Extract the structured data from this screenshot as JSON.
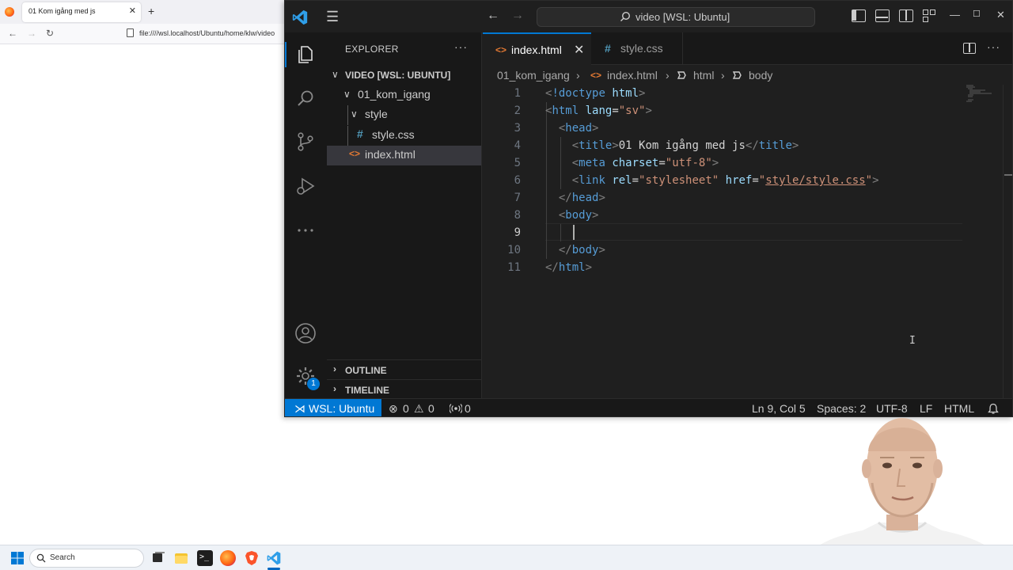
{
  "browser": {
    "tab_title": "01 Kom igång med js",
    "close_glyph": "✕",
    "newtab_glyph": "+",
    "back_glyph": "←",
    "forward_glyph": "→",
    "reload_glyph": "↻",
    "url": "file:////wsl.localhost/Ubuntu/home/klw/video"
  },
  "vscode": {
    "command_center": "video [WSL: Ubuntu]",
    "hamburger": "☰",
    "nav_back": "←",
    "nav_forward": "→",
    "win_min": "—",
    "win_max": "☐",
    "win_close": "✕",
    "explorer": {
      "title": "EXPLORER",
      "more": "···",
      "root": "VIDEO [WSL: UBUNTU]",
      "items": [
        {
          "label": "01_kom_igang",
          "chevron": "∨"
        },
        {
          "label": "style",
          "chevron": "∨"
        },
        {
          "label": "style.css",
          "icon": "#"
        },
        {
          "label": "index.html",
          "icon": "<>"
        }
      ],
      "outline": "OUTLINE",
      "timeline": "TIMELINE",
      "collapsed_chevron": "›",
      "root_chevron": "∨"
    },
    "tabs": [
      {
        "label": "index.html",
        "icon": "<>",
        "close": "✕"
      },
      {
        "label": "style.css",
        "icon": "#"
      }
    ],
    "tab_more": "···",
    "breadcrumbs": {
      "folder": "01_kom_igang",
      "file": "index.html",
      "html": "html",
      "body": "body",
      "sep": "›",
      "icon_html": "<>"
    },
    "editor": {
      "line_numbers": [
        "1",
        "2",
        "3",
        "4",
        "5",
        "6",
        "7",
        "8",
        "9",
        "10",
        "11"
      ],
      "lines": [
        [
          {
            "c": "t-punc",
            "t": "<"
          },
          {
            "c": "t-tag",
            "t": "!doctype"
          },
          {
            "c": "t-text",
            "t": " "
          },
          {
            "c": "t-attr",
            "t": "html"
          },
          {
            "c": "t-punc",
            "t": ">"
          }
        ],
        [
          {
            "c": "t-punc",
            "t": "<"
          },
          {
            "c": "t-tag",
            "t": "html"
          },
          {
            "c": "t-text",
            "t": " "
          },
          {
            "c": "t-attr",
            "t": "lang"
          },
          {
            "c": "t-text",
            "t": "="
          },
          {
            "c": "t-str",
            "t": "\"sv\""
          },
          {
            "c": "t-punc",
            "t": ">"
          }
        ],
        [
          {
            "c": "t-text",
            "t": "  "
          },
          {
            "c": "t-punc",
            "t": "<"
          },
          {
            "c": "t-tag",
            "t": "head"
          },
          {
            "c": "t-punc",
            "t": ">"
          }
        ],
        [
          {
            "c": "t-text",
            "t": "    "
          },
          {
            "c": "t-punc",
            "t": "<"
          },
          {
            "c": "t-tag",
            "t": "title"
          },
          {
            "c": "t-punc",
            "t": ">"
          },
          {
            "c": "t-text",
            "t": "01 Kom igång med js"
          },
          {
            "c": "t-punc",
            "t": "</"
          },
          {
            "c": "t-tag",
            "t": "title"
          },
          {
            "c": "t-punc",
            "t": ">"
          }
        ],
        [
          {
            "c": "t-text",
            "t": "    "
          },
          {
            "c": "t-punc",
            "t": "<"
          },
          {
            "c": "t-tag",
            "t": "meta"
          },
          {
            "c": "t-text",
            "t": " "
          },
          {
            "c": "t-attr",
            "t": "charset"
          },
          {
            "c": "t-text",
            "t": "="
          },
          {
            "c": "t-str",
            "t": "\"utf-8\""
          },
          {
            "c": "t-punc",
            "t": ">"
          }
        ],
        [
          {
            "c": "t-text",
            "t": "    "
          },
          {
            "c": "t-punc",
            "t": "<"
          },
          {
            "c": "t-tag",
            "t": "link"
          },
          {
            "c": "t-text",
            "t": " "
          },
          {
            "c": "t-attr",
            "t": "rel"
          },
          {
            "c": "t-text",
            "t": "="
          },
          {
            "c": "t-str",
            "t": "\"stylesheet\""
          },
          {
            "c": "t-text",
            "t": " "
          },
          {
            "c": "t-attr",
            "t": "href"
          },
          {
            "c": "t-text",
            "t": "="
          },
          {
            "c": "t-str",
            "t": "\""
          },
          {
            "c": "t-link",
            "t": "style/style.css"
          },
          {
            "c": "t-str",
            "t": "\""
          },
          {
            "c": "t-punc",
            "t": ">"
          }
        ],
        [
          {
            "c": "t-text",
            "t": "  "
          },
          {
            "c": "t-punc",
            "t": "</"
          },
          {
            "c": "t-tag",
            "t": "head"
          },
          {
            "c": "t-punc",
            "t": ">"
          }
        ],
        [
          {
            "c": "t-text",
            "t": "  "
          },
          {
            "c": "t-punc",
            "t": "<"
          },
          {
            "c": "t-tag",
            "t": "body"
          },
          {
            "c": "t-punc",
            "t": ">"
          }
        ],
        [
          {
            "c": "t-text",
            "t": "    "
          }
        ],
        [
          {
            "c": "t-text",
            "t": "  "
          },
          {
            "c": "t-punc",
            "t": "</"
          },
          {
            "c": "t-tag",
            "t": "body"
          },
          {
            "c": "t-punc",
            "t": ">"
          }
        ],
        [
          {
            "c": "t-punc",
            "t": "</"
          },
          {
            "c": "t-tag",
            "t": "html"
          },
          {
            "c": "t-punc",
            "t": ">"
          }
        ]
      ],
      "active_line": 9
    },
    "status": {
      "remote": "WSL: Ubuntu",
      "remote_icon": "⋊",
      "errors": "0",
      "warnings": "0",
      "ports": "0",
      "position": "Ln 9, Col 5",
      "spaces": "Spaces: 2",
      "encoding": "UTF-8",
      "eol": "LF",
      "language": "HTML",
      "error_icon": "⊗",
      "warning_icon": "⚠"
    },
    "settings_badge": "1"
  },
  "taskbar": {
    "search": "Search"
  },
  "colors": {
    "accent": "#0078d4",
    "editor_bg": "#1f1f1f",
    "sidebar_bg": "#181818"
  }
}
